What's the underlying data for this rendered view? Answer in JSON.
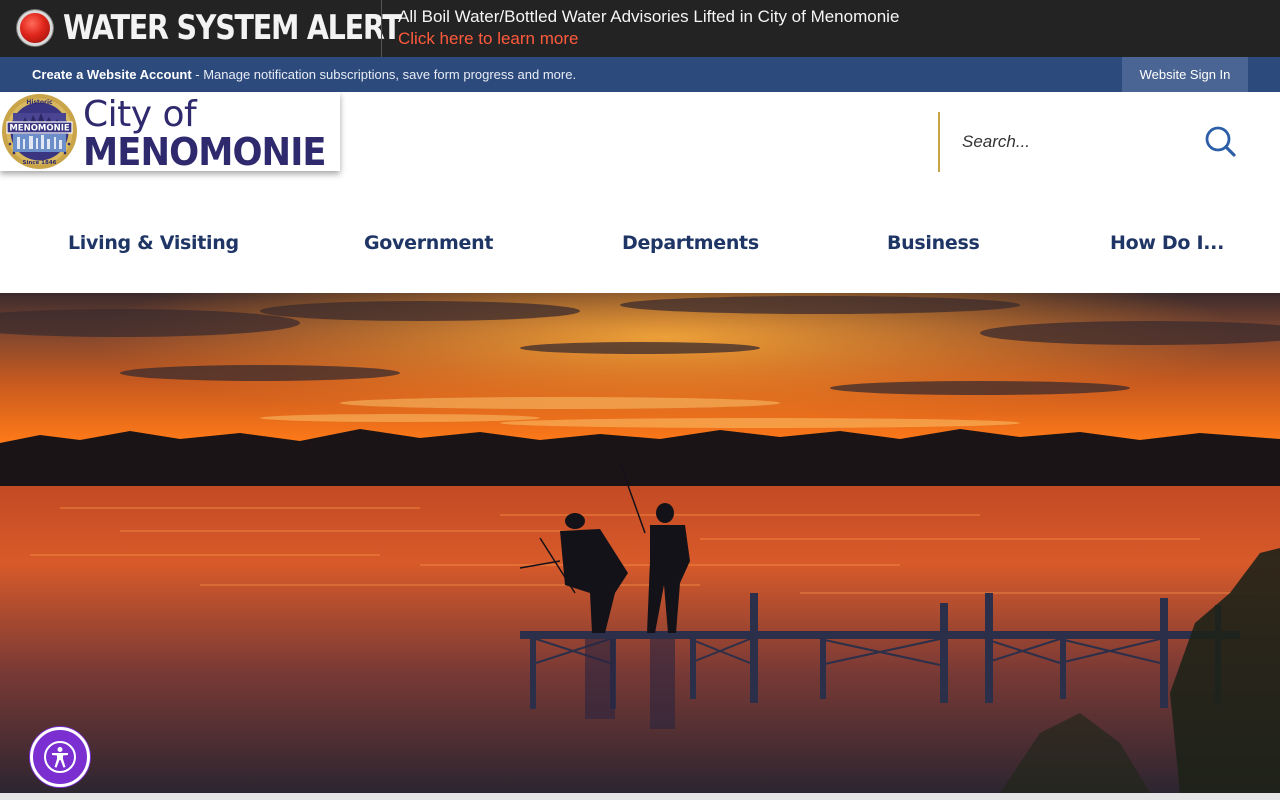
{
  "alert": {
    "title": "WATER SYSTEM ALERT",
    "message": "All Boil Water/Bottled Water Advisories Lifted in City of Menomonie",
    "link": "Click here to learn more",
    "icon": "red-alert-light-icon"
  },
  "account_bar": {
    "create_link": "Create a Website Account",
    "description": " - Manage notification subscriptions, save form progress and more.",
    "sign_in": "Website Sign In"
  },
  "logo": {
    "line1": "City of",
    "line2": "MENOMONIE",
    "seal_top": "Historic",
    "seal_middle": "MENOMONIE",
    "seal_bottom": "Since 1846"
  },
  "search": {
    "placeholder": "Search...",
    "icon": "search-icon"
  },
  "nav": {
    "items": [
      {
        "label": "Living & Visiting"
      },
      {
        "label": "Government"
      },
      {
        "label": "Departments"
      },
      {
        "label": "Business"
      },
      {
        "label": "How Do I..."
      }
    ]
  },
  "hero": {
    "description": "sunset-lake-fishing-dock"
  },
  "accessibility": {
    "icon": "accessibility-icon"
  },
  "colors": {
    "alert_bg": "#232323",
    "alert_link": "#ff5a3c",
    "account_bar": "#2d4a7d",
    "nav_text": "#1e3565",
    "brand_navy": "#2f2a6e",
    "accent_gold": "#c9a449",
    "accessibility_purple": "#7b2fd1"
  }
}
